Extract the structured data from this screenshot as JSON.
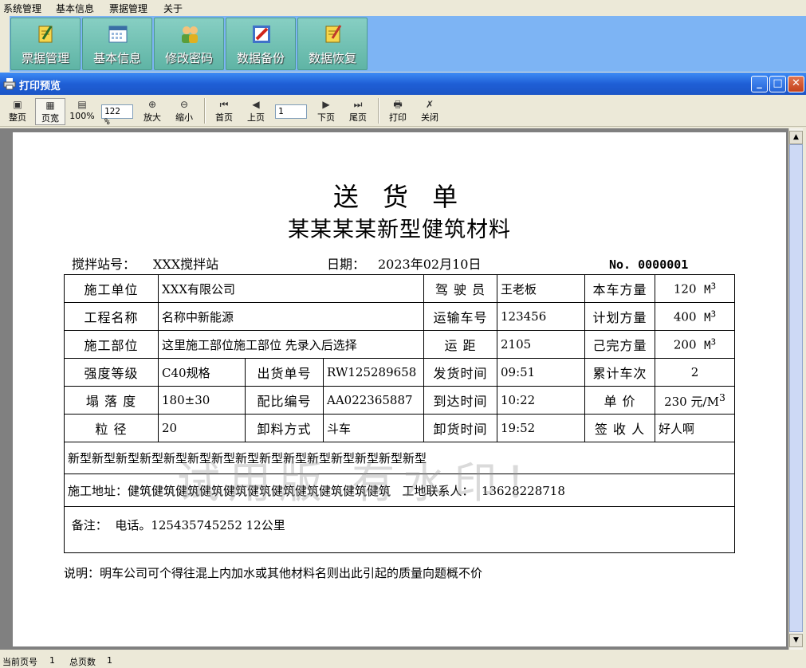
{
  "menubar": {
    "items": [
      "系统管理",
      "基本信息",
      "票据管理",
      "关于"
    ]
  },
  "app_toolbar": {
    "buttons": [
      {
        "label": "票据管理",
        "icon": "notepad-icon"
      },
      {
        "label": "基本信息",
        "icon": "calendar-icon"
      },
      {
        "label": "修改密码",
        "icon": "users-icon"
      },
      {
        "label": "数据备份",
        "icon": "backup-icon"
      },
      {
        "label": "数据恢复",
        "icon": "restore-icon"
      }
    ],
    "background_color": "#7db4f4",
    "button_color": "#6dbfb0"
  },
  "window": {
    "title": "打印预览",
    "title_color": "#1f5fd6"
  },
  "preview_toolbar": {
    "whole_page": "整页",
    "page_width": "页宽",
    "zoom_100": "100%",
    "zoom_value": "122 %",
    "zoom_in": "放大",
    "zoom_out": "缩小",
    "first_page": "首页",
    "prev_page": "上页",
    "page_input": "1",
    "next_page": "下页",
    "last_page": "尾页",
    "print": "打印",
    "close": "关闭"
  },
  "document": {
    "title": "送 货 单",
    "subtitle": "某某某某新型健筑材料",
    "station_label": "搅拌站号：",
    "station_value": "XXX搅拌站",
    "date_label": "日期：",
    "date_value": "2023年02月10日",
    "ticket_no": "No. 0000001",
    "table": {
      "r1": {
        "l1": "施工单位",
        "v1": "XXX有限公司",
        "l2": "驾 驶 员",
        "v2": "王老板",
        "l3": "本车方量",
        "v3": "120",
        "u3": "M",
        "s3": "3"
      },
      "r2": {
        "l1": "工程名称",
        "v1": "名称中新能源",
        "l2": "运输车号",
        "v2": "123456",
        "l3": "计划方量",
        "v3": "400",
        "u3": "M",
        "s3": "3"
      },
      "r3": {
        "l1": "施工部位",
        "v1": "这里施工部位施工部位 先录入后选择",
        "l2": "运  距",
        "v2": "2105",
        "l3": "己完方量",
        "v3": "200",
        "u3": "M",
        "s3": "3"
      },
      "r4": {
        "l1": "强度等级",
        "v1": "C40规格",
        "l1b": "出货单号",
        "v1b": "RW125289658",
        "l2": "发货时间",
        "v2": "09:51",
        "l3": "累计车次",
        "v3": "2"
      },
      "r5": {
        "l1": "塌 落 度",
        "v1": "180±30",
        "l1b": "配比编号",
        "v1b": "AA022365887",
        "l2": "到达时间",
        "v2": "10:22",
        "l3": "单  价",
        "v3": "230",
        "u3": "元/M",
        "s3": "3"
      },
      "r6": {
        "l1": "粒  径",
        "v1": "20",
        "l1b": "卸料方式",
        "v1b": "斗车",
        "l2": "卸货时间",
        "v2": "19:52",
        "l3": "签 收 人",
        "v3": "好人啊"
      },
      "material_line": "新型新型新型新型新型新型新型新型新型新型新型新型新型新型新型",
      "address_label": "施工地址：",
      "address_value": "健筑健筑健筑健筑健筑健筑健筑健筑健筑健筑健筑",
      "contact_label": "工地联系人：",
      "contact_value": "13628228718",
      "remark_label": "备注：",
      "remark_value": "电话。125435745252 12公里"
    },
    "watermark": "试用版 有水印！",
    "note": "说明：明车公司可个得往混上内加水或其他材料名则出此引起的质量向题概不价"
  },
  "statusbar": {
    "current_label": "当前页号",
    "current_value": "1",
    "total_label": "总页数",
    "total_value": "1"
  }
}
